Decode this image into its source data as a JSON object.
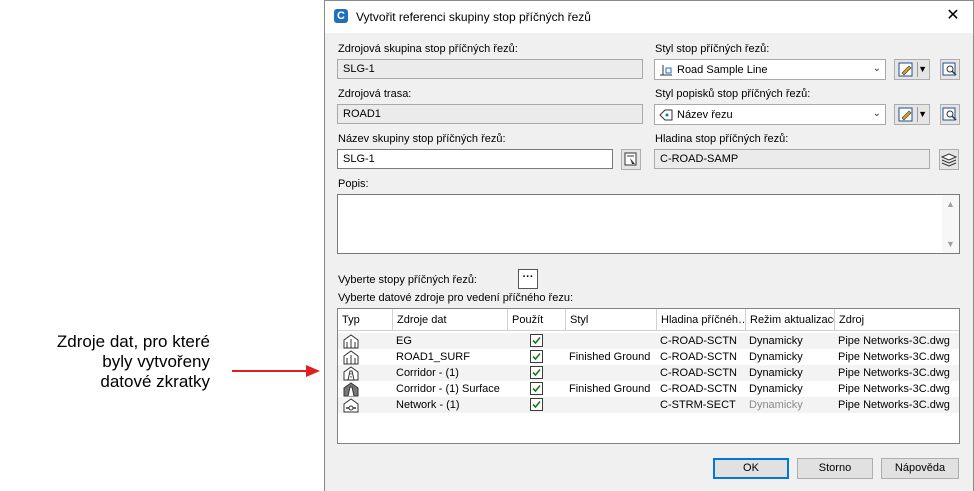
{
  "callout": {
    "line1": "Zdroje dat, pro které",
    "line2": "byly vytvořeny",
    "line3": "datové zkratky"
  },
  "dialog": {
    "title": "Vytvořit referenci skupiny stop příčných řezů",
    "close": "✕"
  },
  "form": {
    "source_group_label": "Zdrojová skupina stop příčných řezů:",
    "source_group_value": "SLG-1",
    "source_alignment_label": "Zdrojová trasa:",
    "source_alignment_value": "ROAD1",
    "group_name_label": "Název skupiny stop příčných řezů:",
    "group_name_value": "SLG-1",
    "sample_line_style_label": "Styl stop příčných řezů:",
    "sample_line_style_value": "Road Sample Line",
    "label_style_label": "Styl popisků stop příčných řezů:",
    "label_style_value": "Název řezu",
    "layer_label": "Hladina stop příčných řezů:",
    "layer_value": "C-ROAD-SAMP",
    "description_label": "Popis:",
    "select_sample_lines_label": "Vyberte stopy příčných řezů:",
    "select_sources_label": "Vyberte datové zdroje pro vedení příčného řezu:"
  },
  "grid": {
    "headers": [
      "Typ",
      "Zdroje dat",
      "Použít",
      "Styl",
      "Hladina příčnéh…",
      "Režim aktualizace",
      "Zdroj"
    ],
    "rows": [
      {
        "type_icon": "surface-icon",
        "source": "EG",
        "use": true,
        "style": "",
        "layer": "C-ROAD-SCTN",
        "mode": "Dynamicky",
        "origin": "Pipe Networks-3C.dwg"
      },
      {
        "type_icon": "surface-icon",
        "source": "ROAD1_SURF",
        "use": true,
        "style": "Finished Ground",
        "layer": "C-ROAD-SCTN",
        "mode": "Dynamicky",
        "origin": "Pipe Networks-3C.dwg"
      },
      {
        "type_icon": "corridor-icon",
        "source": "Corridor - (1)",
        "use": true,
        "style": "",
        "layer": "C-ROAD-SCTN",
        "mode": "Dynamicky",
        "origin": "Pipe Networks-3C.dwg"
      },
      {
        "type_icon": "corridor-surface-icon",
        "source": "Corridor - (1) Surface",
        "use": true,
        "style": "Finished Ground",
        "layer": "C-ROAD-SCTN",
        "mode": "Dynamicky",
        "origin": "Pipe Networks-3C.dwg"
      },
      {
        "type_icon": "pipe-network-icon",
        "source": "Network - (1)",
        "use": true,
        "style": "",
        "layer": "C-STRM-SECT",
        "mode": "Dynamicky",
        "origin": "Pipe Networks-3C.dwg"
      }
    ]
  },
  "buttons": {
    "ok": "OK",
    "cancel": "Storno",
    "help": "Nápověda",
    "ellipsis": "···"
  },
  "colors": {
    "arrow": "#e02020",
    "accent": "#0078d7",
    "check": "#1e7a1e"
  }
}
